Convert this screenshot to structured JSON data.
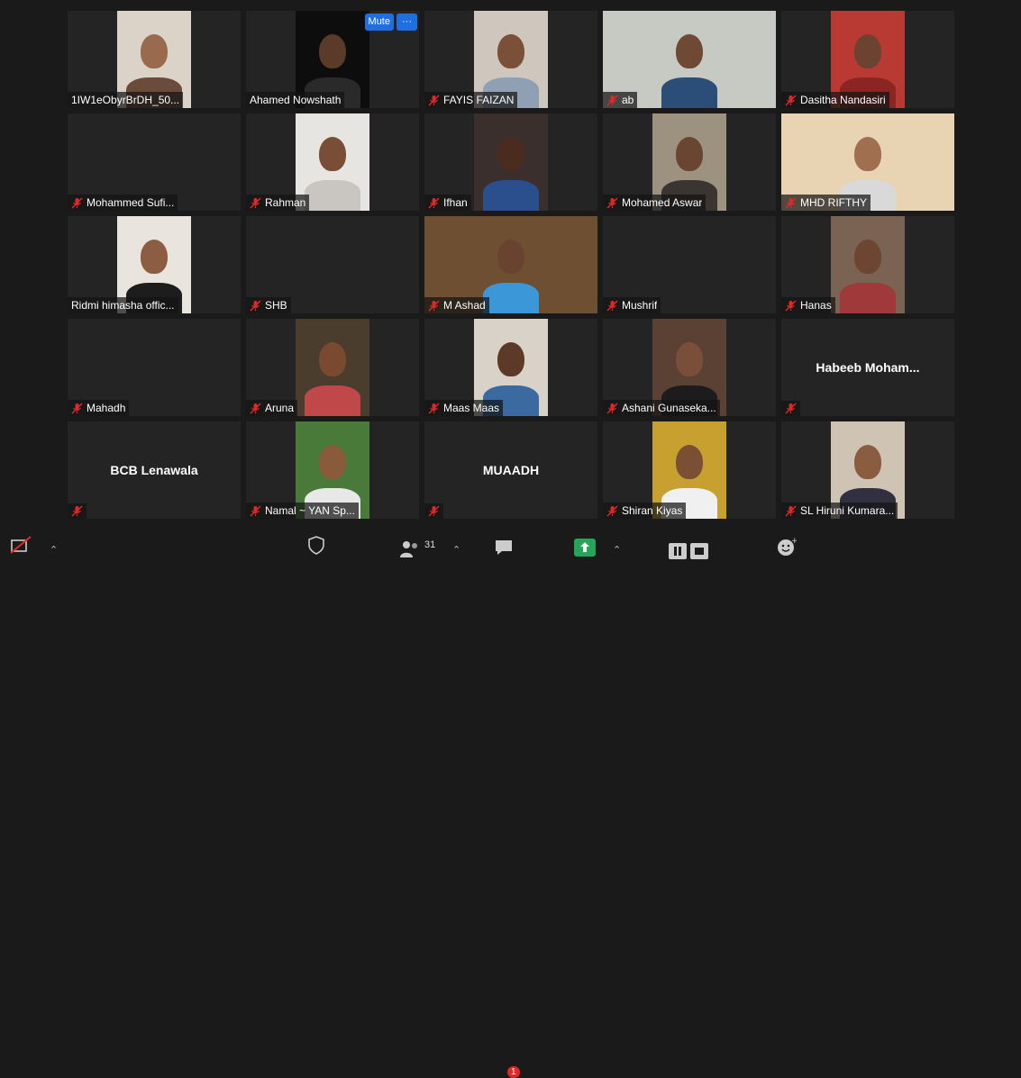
{
  "participants": [
    {
      "name": "1IW1eObyrBrDH_50...",
      "muted": false,
      "video": true,
      "bg": "#dcd3c8",
      "skin": "#9a6a4f",
      "shirt": "#6b4c3b"
    },
    {
      "name": "Ahamed Nowshath",
      "muted": false,
      "video": true,
      "bg": "#0d0d0d",
      "skin": "#5a3a28",
      "shirt": "#2a2a2a"
    },
    {
      "name": "FAYIS FAIZAN",
      "muted": true,
      "video": true,
      "bg": "#cfc7be",
      "skin": "#7a5038",
      "shirt": "#8fa0b5"
    },
    {
      "name": "ab",
      "muted": true,
      "video": true,
      "bg": "#c7c9c3",
      "skin": "#6e4a34",
      "shirt": "#2b4e78",
      "wide": true
    },
    {
      "name": "Dasitha Nandasiri",
      "muted": true,
      "video": true,
      "bg": "#b93a33",
      "skin": "#6b4330",
      "shirt": "#8a2522"
    },
    {
      "name": "Mohammed Sufi...",
      "muted": true,
      "video": false
    },
    {
      "name": "Rahman",
      "muted": true,
      "video": true,
      "bg": "#e7e5e1",
      "skin": "#7a4e36",
      "shirt": "#c9c6c1"
    },
    {
      "name": "Ifhan",
      "muted": true,
      "video": true,
      "bg": "#3b2f2d",
      "skin": "#4a2c1f",
      "shirt": "#2a4f8c"
    },
    {
      "name": "Mohamed Aswar",
      "muted": true,
      "video": true,
      "bg": "#9d9180",
      "skin": "#6a4632",
      "shirt": "#3a3530"
    },
    {
      "name": "MHD RIFTHY",
      "muted": true,
      "video": true,
      "bg": "#e8d3b3",
      "skin": "#a06f4f",
      "shirt": "#d9d9d9",
      "wide": true
    },
    {
      "name": "Ridmi  himasha offic...",
      "muted": false,
      "video": true,
      "bg": "#e9e4dd",
      "skin": "#8c5d42",
      "shirt": "#1d1d1d"
    },
    {
      "name": "SHB",
      "muted": true,
      "video": false
    },
    {
      "name": "M Ashad",
      "muted": true,
      "video": true,
      "bg": "#6e4f31",
      "skin": "#6a4330",
      "shirt": "#3b97d8",
      "wide": true
    },
    {
      "name": "Mushrif",
      "muted": true,
      "video": false
    },
    {
      "name": "Hanas",
      "muted": true,
      "video": true,
      "bg": "#7b6354",
      "skin": "#6d4632",
      "shirt": "#a03a3a"
    },
    {
      "name": "Mahadh",
      "muted": true,
      "video": false
    },
    {
      "name": "Aruna",
      "muted": true,
      "video": true,
      "bg": "#4a3d2e",
      "skin": "#7a4a30",
      "shirt": "#c04848"
    },
    {
      "name": "Maas Maas",
      "muted": true,
      "video": true,
      "bg": "#d8d2c8",
      "skin": "#5d3a27",
      "shirt": "#3a6aa0"
    },
    {
      "name": "Ashani Gunaseka...",
      "muted": true,
      "video": true,
      "bg": "#5b4034",
      "skin": "#7a4f3a",
      "shirt": "#1c1c1c"
    },
    {
      "name": "",
      "display_name": "Habeeb  Moham...",
      "muted": true,
      "video": false
    },
    {
      "name": "",
      "display_name": "BCB Lenawala",
      "muted": true,
      "video": false
    },
    {
      "name": "Namal ~ YAN Sp...",
      "muted": true,
      "video": true,
      "bg": "#4a7a3a",
      "skin": "#8a5a3d",
      "shirt": "#e8e8e8"
    },
    {
      "name": "",
      "display_name": "MUAADH",
      "muted": true,
      "video": false
    },
    {
      "name": "Shiran Kiyas",
      "muted": true,
      "video": true,
      "bg": "#c8a030",
      "skin": "#7a4f34",
      "shirt": "#f0f0f0"
    },
    {
      "name": "SL Hiruni Kumara...",
      "muted": true,
      "video": true,
      "bg": "#cfc4b3",
      "skin": "#8a5c40",
      "shirt": "#303040"
    }
  ],
  "hover_buttons": {
    "mute_label": "Mute",
    "more_label": "···"
  },
  "toolbar": {
    "participant_count": "31",
    "chat_badge": "1"
  },
  "colors": {
    "background": "#1a1a1a",
    "tile": "#242424",
    "accent_blue": "#1f6fe0",
    "mute_red": "#e02828",
    "share_green": "#23a55a"
  }
}
